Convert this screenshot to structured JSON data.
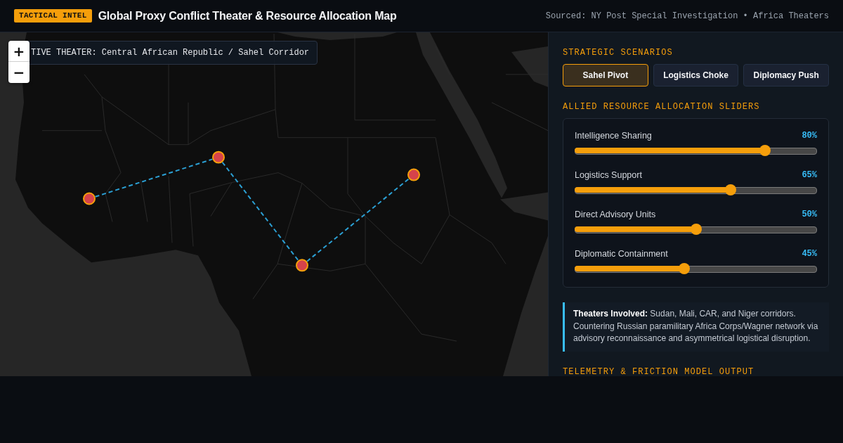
{
  "header": {
    "badge": "TACTICAL INTEL",
    "title": "Global Proxy Conflict Theater & Resource Allocation Map",
    "source": "Sourced: NY Post Special Investigation • Africa Theaters"
  },
  "map": {
    "zoom_controls": [
      "+",
      "−"
    ],
    "theater_label": "TIVE THEATER: Central African Republic / Sahel Corridor"
  },
  "panel": {
    "scenarios": {
      "heading": "STRATEGIC SCENARIOS",
      "options": [
        {
          "label": "Sahel Pivot",
          "selected": true
        },
        {
          "label": "Logistics Choke",
          "selected": false
        },
        {
          "label": "Diplomacy Push",
          "selected": false
        }
      ]
    },
    "sliders": {
      "heading": "ALLIED RESOURCE ALLOCATION SLIDERS",
      "items": [
        {
          "label": "Intelligence Sharing",
          "level": 0.8,
          "reading": "80%"
        },
        {
          "label": "Logistics Support",
          "level": 0.65,
          "reading": "65%"
        },
        {
          "label": "Direct Advisory Units",
          "level": 0.5,
          "reading": "50%"
        },
        {
          "label": "Diplomatic Containment",
          "level": 0.45,
          "reading": "45%"
        }
      ]
    },
    "note": "**Theaters Involved:** Sudan, Mali, CAR, and Niger corridors. Countering Russian paramilitary Africa Corps/Wagner network via advisory reconnaissance and asymmetrical logistical disruption.",
    "telemetry": {
      "heading": "TELEMETRY & FRICTION MODEL OUTPUT"
    }
  }
}
